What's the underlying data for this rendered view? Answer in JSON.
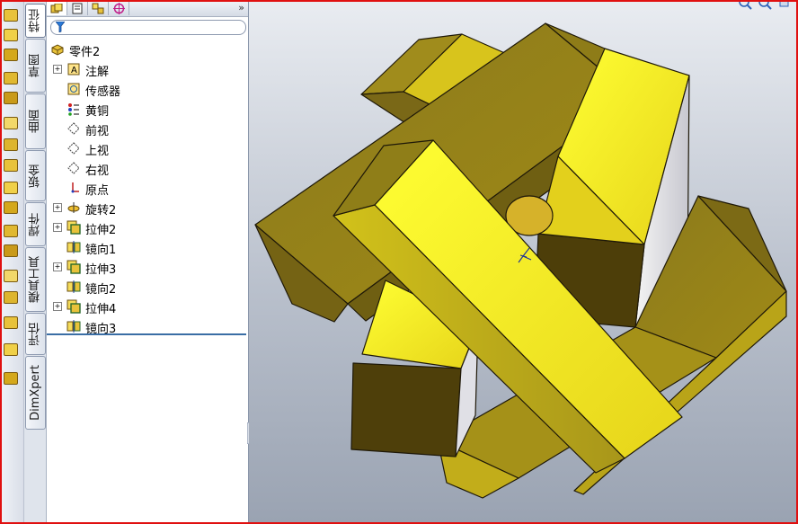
{
  "command_strip": {
    "icons": [
      "extrude-icon",
      "revolve-icon",
      "sweep-icon",
      "loft-icon",
      "fillet-icon",
      "chamfer-icon",
      "rib-icon",
      "draft-icon",
      "shell-icon",
      "wrap-icon",
      "dome-icon",
      "pattern-icon",
      "mirror-icon",
      "hole-icon",
      "reference-icon",
      "curve-icon",
      "instant3d-icon"
    ]
  },
  "vertical_tabs": [
    {
      "label": "特征",
      "active": true
    },
    {
      "label": "草图",
      "active": false
    },
    {
      "label": "曲面",
      "active": false
    },
    {
      "label": "钣金",
      "active": false
    },
    {
      "label": "焊件",
      "active": false
    },
    {
      "label": "模具工具",
      "active": false
    },
    {
      "label": "评估",
      "active": false
    },
    {
      "label": "DimXpert",
      "active": false
    }
  ],
  "panel_tabs": [
    "featuremanager-tab-icon",
    "propertymanager-tab-icon",
    "configurationmanager-tab-icon",
    "dimxpert-manager-tab-icon"
  ],
  "panel_expand": "»",
  "tree": {
    "root": {
      "label": "零件2",
      "icon": "part-icon"
    },
    "items": [
      {
        "label": "注解",
        "icon": "annotations-icon",
        "expandable": true
      },
      {
        "label": "传感器",
        "icon": "sensors-icon",
        "expandable": false
      },
      {
        "label": "黄铜",
        "icon": "material-icon",
        "expandable": false
      },
      {
        "label": "前视",
        "icon": "plane-icon",
        "expandable": false
      },
      {
        "label": "上视",
        "icon": "plane-icon",
        "expandable": false
      },
      {
        "label": "右视",
        "icon": "plane-icon",
        "expandable": false
      },
      {
        "label": "原点",
        "icon": "origin-icon",
        "expandable": false
      },
      {
        "label": "旋转2",
        "icon": "revolve-feature-icon",
        "expandable": true
      },
      {
        "label": "拉伸2",
        "icon": "extrude-feature-icon",
        "expandable": true
      },
      {
        "label": "镜向1",
        "icon": "mirror-feature-icon",
        "expandable": false
      },
      {
        "label": "拉伸3",
        "icon": "extrude-feature-icon",
        "expandable": true
      },
      {
        "label": "镜向2",
        "icon": "mirror-feature-icon",
        "expandable": false
      },
      {
        "label": "拉伸4",
        "icon": "extrude-feature-icon",
        "expandable": true
      },
      {
        "label": "镜向3",
        "icon": "mirror-feature-icon",
        "expandable": false
      }
    ]
  },
  "colors": {
    "frame_border": "#e01010",
    "part_light": "#ffff22",
    "part_mid": "#c9b41a",
    "part_dark": "#8a7418",
    "part_shadow": "#4f3f0a",
    "rollback_bar": "#3a6ea5"
  },
  "viewport": {
    "origin_triad": "triad-icon"
  }
}
